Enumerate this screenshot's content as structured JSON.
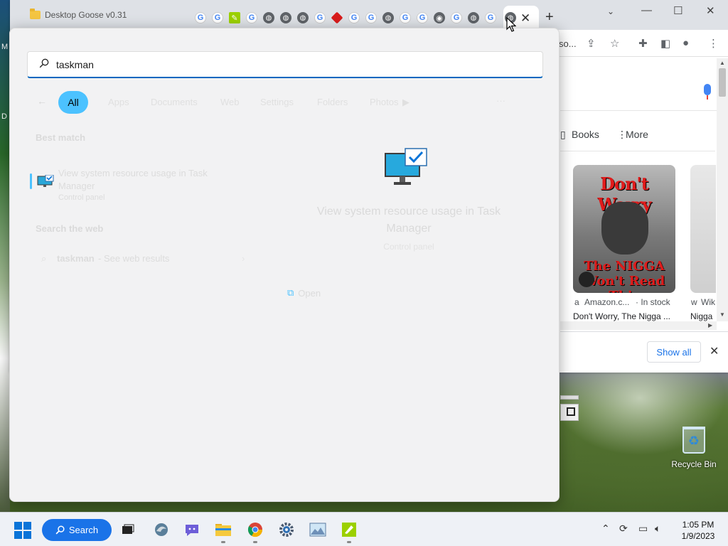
{
  "browser": {
    "window_tab_title": "Desktop Goose v0.31",
    "tab_favicons": [
      "g",
      "g",
      "green",
      "g",
      "globe",
      "globe",
      "globe",
      "g",
      "red",
      "g",
      "g",
      "globe",
      "g",
      "chrome",
      "g",
      "globe-active"
    ],
    "address_partial": "so...",
    "google": {
      "nav_books": "Books",
      "nav_more": "More",
      "book_cover_title": "Don't Worry",
      "book_cover_subtitle": "The NIGGA Won't Read This",
      "result_source": "Amazon.c...",
      "result_stock": "· In stock",
      "result_title": "Don't Worry, The Nigga ...",
      "result2_source": "Wik",
      "result2_title": "Nigga",
      "show_all": "Show all"
    }
  },
  "desktop": {
    "left_marks": [
      "M",
      "D"
    ],
    "recycle_bin_label": "Recycle Bin"
  },
  "search": {
    "query": "taskman",
    "filters": {
      "all": "All",
      "others": [
        "Apps",
        "Documents",
        "Web",
        "Settings",
        "Folders",
        "Photos",
        "▶"
      ],
      "more": "···"
    },
    "best_match_heading": "Best match",
    "best_match": {
      "line1": "View system resource usage in Task",
      "line2": "Manager",
      "line3": "Control panel"
    },
    "search_web_heading": "Search the web",
    "web_suggestion_bold": "taskman",
    "web_suggestion_rest": " - See web results",
    "detail": {
      "title": "View system resource usage in Task Manager",
      "subtitle": "Control panel",
      "open_label": "Open"
    }
  },
  "taskbar": {
    "search_label": "Search",
    "time": "1:05 PM",
    "date": "1/9/2023"
  },
  "colors": {
    "accent": "#4cc2ff",
    "taskbar_search": "#1a73e8",
    "windows_blue": "#0a74d8"
  }
}
